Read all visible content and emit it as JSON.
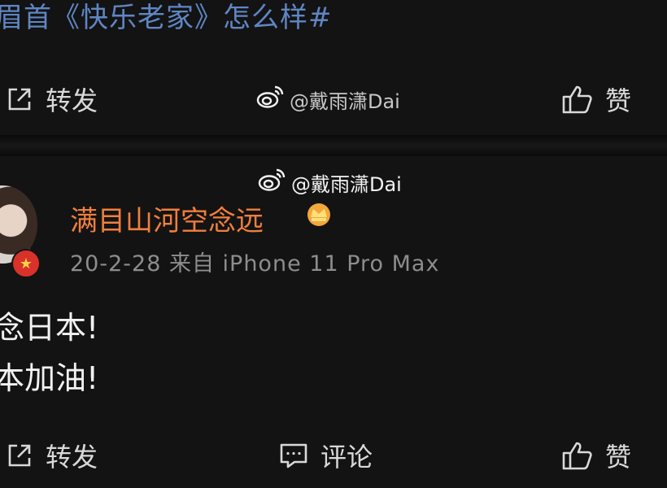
{
  "post_above": {
    "topic_text": "眉首《快乐老家》怎么样#",
    "actions": {
      "repost_label": "转发",
      "like_label": "赞"
    }
  },
  "watermark_text": "@戴雨潇Dai",
  "post": {
    "author": {
      "name": "满目山河空念远"
    },
    "meta": "20-2-28  来自 iPhone 11 Pro Max",
    "lines": [
      "念日本!",
      "本加油!"
    ],
    "actions": {
      "repost_label": "转发",
      "comment_label": "评论",
      "like_label": "赞"
    }
  },
  "colors": {
    "background": "#131313",
    "topic_link": "#5f86c4",
    "username": "#f07f3d",
    "meta_text": "#8d8d8d"
  }
}
